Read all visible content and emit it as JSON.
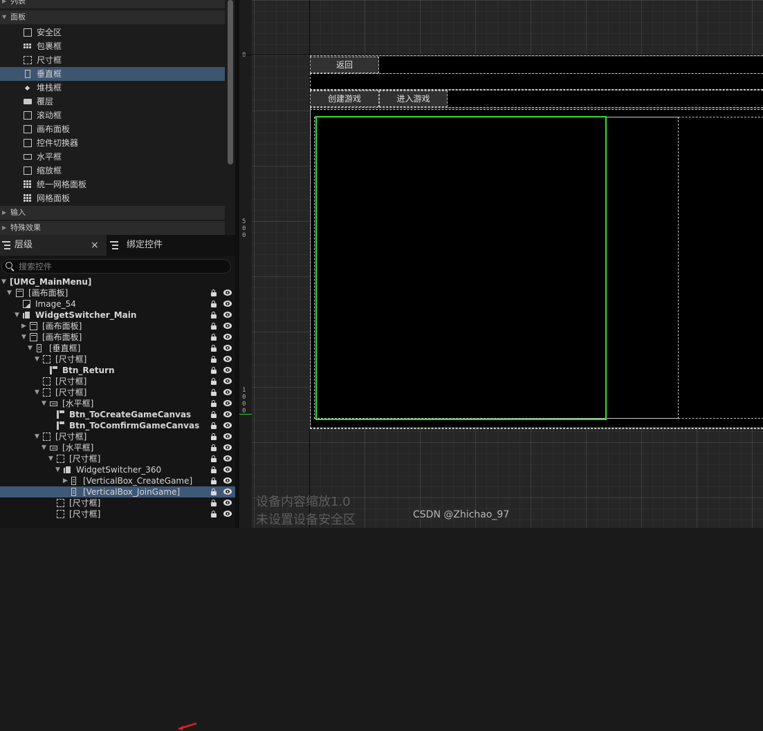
{
  "palette": {
    "categories": [
      {
        "label": "列表",
        "expanded": false
      },
      {
        "label": "面板",
        "expanded": true
      },
      {
        "label": "输入",
        "expanded": false
      },
      {
        "label": "特殊效果",
        "expanded": false
      }
    ],
    "items": [
      {
        "label": "安全区",
        "icon": "safe-zone-icon"
      },
      {
        "label": "包裹框",
        "icon": "wrap-box-icon"
      },
      {
        "label": "尺寸框",
        "icon": "size-box-icon"
      },
      {
        "label": "垂直框",
        "icon": "vertical-box-icon",
        "selected": true
      },
      {
        "label": "堆栈框",
        "icon": "stack-box-icon"
      },
      {
        "label": "覆层",
        "icon": "overlay-icon"
      },
      {
        "label": "滚动框",
        "icon": "scroll-box-icon"
      },
      {
        "label": "画布面板",
        "icon": "canvas-panel-icon"
      },
      {
        "label": "控件切换器",
        "icon": "widget-switcher-icon"
      },
      {
        "label": "水平框",
        "icon": "horizontal-box-icon"
      },
      {
        "label": "缩放框",
        "icon": "scale-box-icon"
      },
      {
        "label": "统一网格面板",
        "icon": "uniform-grid-icon"
      },
      {
        "label": "网格面板",
        "icon": "grid-panel-icon"
      }
    ]
  },
  "hierarchy": {
    "tab_label": "层级",
    "close_glyph": "×",
    "bind_tab_label": "绑定控件",
    "search_placeholder": "搜索控件",
    "nodes": [
      {
        "label": "[UMG_MainMenu]",
        "bold": true
      },
      {
        "label": "[画布面板]"
      },
      {
        "label": "Image_54"
      },
      {
        "label": "WidgetSwitcher_Main",
        "bold": true
      },
      {
        "label": "[画布面板]"
      },
      {
        "label": "[画布面板]"
      },
      {
        "label": "[垂直框]"
      },
      {
        "label": "[尺寸框]"
      },
      {
        "label": "Btn_Return",
        "bold": true
      },
      {
        "label": "[尺寸框]"
      },
      {
        "label": "[尺寸框]"
      },
      {
        "label": "[水平框]"
      },
      {
        "label": "Btn_ToCreateGameCanvas",
        "bold": true
      },
      {
        "label": "Btn_ToComfirmGameCanvas",
        "bold": true
      },
      {
        "label": "[尺寸框]"
      },
      {
        "label": "[水平框]"
      },
      {
        "label": "[尺寸框]"
      },
      {
        "label": "WidgetSwitcher_360"
      },
      {
        "label": "[VerticalBox_CreateGame]"
      },
      {
        "label": "[VerticalBox_JoinGame]",
        "selected": true
      },
      {
        "label": "[尺寸框]"
      },
      {
        "label": "[尺寸框]"
      }
    ]
  },
  "designer": {
    "ruler_labels": [
      "0",
      "5\n0\n0",
      "1\n0\n0\n0"
    ],
    "buttons": {
      "return": "返回",
      "create_game": "创建游戏",
      "join_game": "进入游戏"
    },
    "watermark_line1": "设备内容缩放1.0",
    "watermark_line2": "未设置设备安全区",
    "credit": "CSDN @Zhichao_97",
    "selection_color": "#34e034",
    "canvas_bg": "#262626"
  }
}
